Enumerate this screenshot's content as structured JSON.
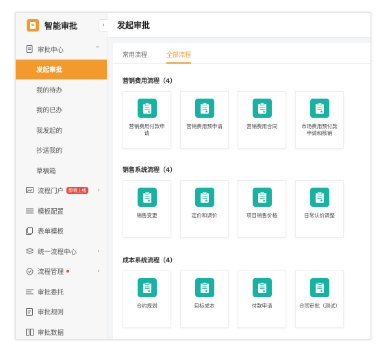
{
  "app": {
    "title": "智能审批",
    "collapse_icon": "chevron-left-icon"
  },
  "sidebar": {
    "items": [
      {
        "label": "审批中心",
        "icon": "document-icon",
        "expanded": true
      },
      {
        "label": "发起审批",
        "active": true
      },
      {
        "label": "我的待办"
      },
      {
        "label": "我的已办"
      },
      {
        "label": "我发起的"
      },
      {
        "label": "抄送我的"
      },
      {
        "label": "草稿箱"
      },
      {
        "label": "流程门户",
        "icon": "portal-icon",
        "badge": "即将上线"
      },
      {
        "label": "模板配置",
        "icon": "template-icon"
      },
      {
        "label": "表单模板",
        "icon": "form-icon"
      },
      {
        "label": "统一流程中心",
        "icon": "flow-center-icon"
      },
      {
        "label": "流程管理",
        "icon": "flow-manage-icon",
        "dot": true
      },
      {
        "label": "审批委托",
        "icon": "delegate-icon"
      },
      {
        "label": "审批规则",
        "icon": "rules-icon"
      },
      {
        "label": "审批数据",
        "icon": "data-icon"
      }
    ]
  },
  "main": {
    "title": "发起审批",
    "tabs": [
      {
        "label": "常用流程",
        "active": false
      },
      {
        "label": "全部流程",
        "active": true
      }
    ],
    "sections": [
      {
        "title": "营销费用流程（4）",
        "cards": [
          "营销费用付款申请",
          "营销费用预申请",
          "营销费用合同",
          "市场费用预付款申请和核销"
        ]
      },
      {
        "title": "销售系统流程（4）",
        "cards": [
          "销售变更",
          "定价和调价",
          "项目销售价格",
          "日常认价调整"
        ]
      },
      {
        "title": "成本系统流程（4）",
        "cards": [
          "合约规划",
          "目标成本",
          "付款申请",
          "合同审批（测试）"
        ]
      }
    ]
  },
  "colors": {
    "accent": "#f39a2c",
    "card_icon": "#16b3a3",
    "badge": "#e9493f"
  }
}
